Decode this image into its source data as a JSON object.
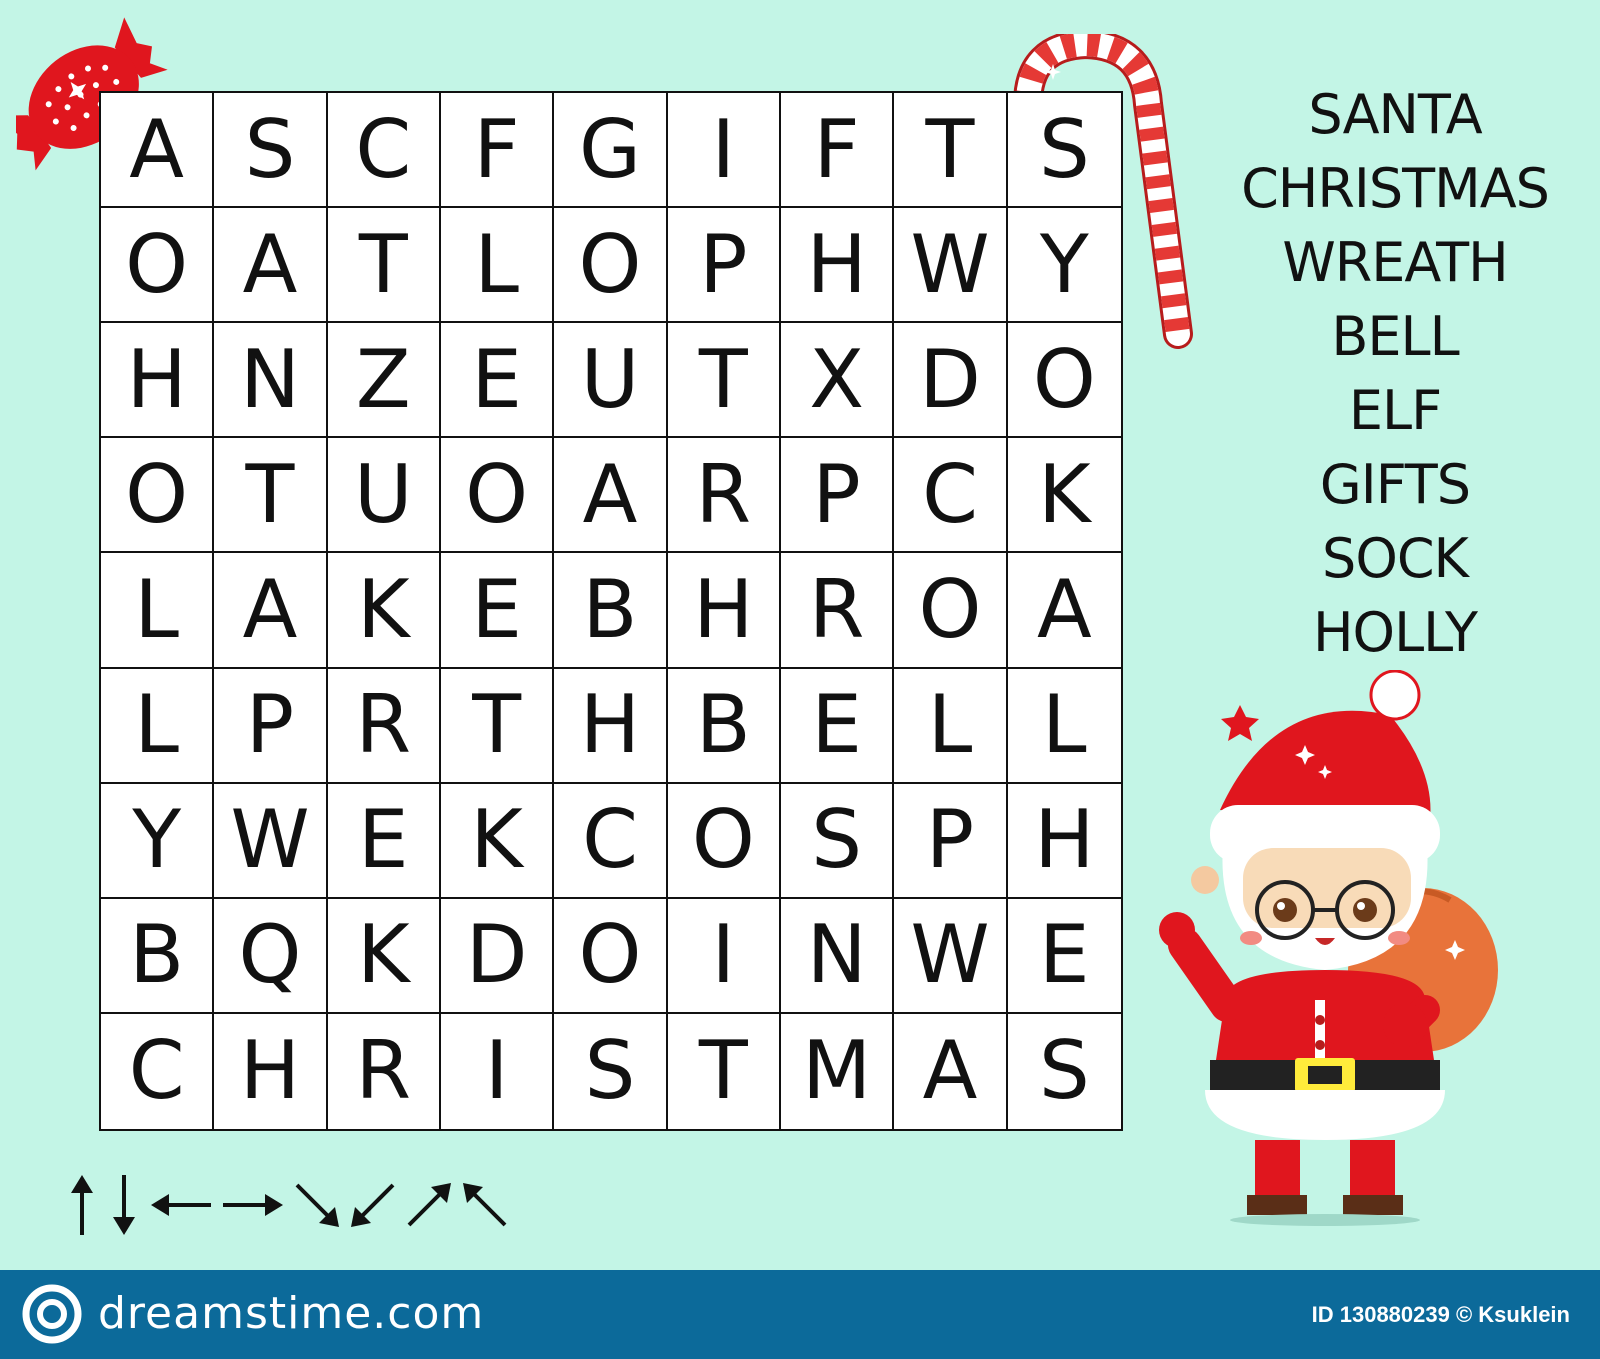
{
  "grid": {
    "rows": [
      [
        "A",
        "S",
        "C",
        "F",
        "G",
        "I",
        "F",
        "T",
        "S"
      ],
      [
        "O",
        "A",
        "T",
        "L",
        "O",
        "P",
        "H",
        "W",
        "Y"
      ],
      [
        "H",
        "N",
        "Z",
        "E",
        "U",
        "T",
        "X",
        "D",
        "O"
      ],
      [
        "O",
        "T",
        "U",
        "O",
        "A",
        "R",
        "P",
        "C",
        "K"
      ],
      [
        "L",
        "A",
        "K",
        "E",
        "B",
        "H",
        "R",
        "O",
        "A"
      ],
      [
        "L",
        "P",
        "R",
        "T",
        "H",
        "B",
        "E",
        "L",
        "L"
      ],
      [
        "Y",
        "W",
        "E",
        "K",
        "C",
        "O",
        "S",
        "P",
        "H"
      ],
      [
        "B",
        "Q",
        "K",
        "D",
        "O",
        "I",
        "N",
        "W",
        "E"
      ],
      [
        "C",
        "H",
        "R",
        "I",
        "S",
        "T",
        "M",
        "A",
        "S"
      ]
    ]
  },
  "words": [
    "SANTA",
    "CHRISTMAS",
    "WREATH",
    "BELL",
    "ELF",
    "GIFTS",
    "SOCK",
    "HOLLY"
  ],
  "directions": [
    "up-arrow-icon",
    "down-arrow-icon",
    "left-arrow-icon",
    "right-arrow-icon",
    "down-right-arrow-icon",
    "down-left-arrow-icon",
    "up-right-arrow-icon",
    "up-left-arrow-icon"
  ],
  "footer": {
    "brand": "dreamstime.com",
    "image_id": "ID 130880239 © Ksuklein"
  },
  "colors": {
    "background": "#c3f5e6",
    "footer": "#0c6a9a",
    "santa_red": "#e0161e",
    "candy_stripe": "#e53935"
  }
}
